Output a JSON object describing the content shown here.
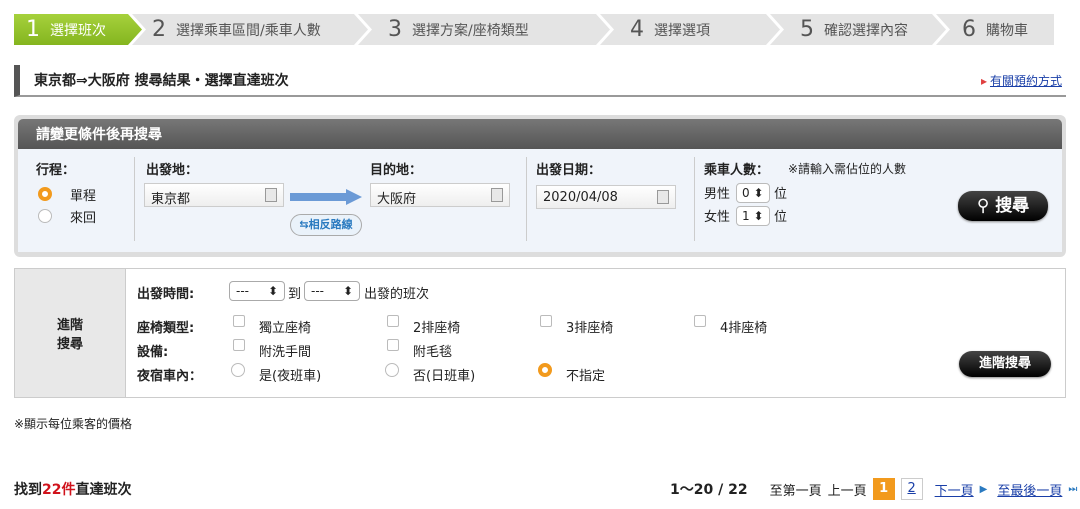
{
  "steps": [
    {
      "num": "1",
      "label": "選擇班次"
    },
    {
      "num": "2",
      "label": "選擇乘車區間/乘車人數"
    },
    {
      "num": "3",
      "label": "選擇方案/座椅類型"
    },
    {
      "num": "4",
      "label": "選擇選項"
    },
    {
      "num": "5",
      "label": "確認選擇內容"
    },
    {
      "num": "6",
      "label": "購物車"
    }
  ],
  "title": "東京都⇒大阪府 搜尋結果・選擇直達班次",
  "howto_link": "有關預約方式",
  "search": {
    "header": "請變更條件後再搜尋",
    "trip_label": "行程：",
    "one_way": "單程",
    "round_trip": "來回",
    "from_label": "出發地：",
    "from_value": "東京都",
    "to_label": "目的地：",
    "to_value": "大阪府",
    "reverse": "相反路線",
    "date_label": "出發日期：",
    "date_value": "2020/04/08",
    "pax_label": "乘車人數：",
    "pax_note": "※請輸入需佔位的人數",
    "male": "男性",
    "male_count": "0",
    "female": "女性",
    "female_count": "1",
    "unit": "位",
    "search_button": "搜尋"
  },
  "advanced": {
    "title_line1": "進階",
    "title_line2": "搜尋",
    "time_label": "出發時間:",
    "time_from": "---",
    "to": "到",
    "time_to": "---",
    "time_suffix": "出發的班次",
    "seat_label": "座椅類型:",
    "seats": [
      "獨立座椅",
      "2排座椅",
      "3排座椅",
      "4排座椅"
    ],
    "equip_label": "設備:",
    "equip": [
      "附洗手間",
      "附毛毯"
    ],
    "night_label": "夜宿車內：",
    "night": [
      "是(夜班車)",
      "否(日班車)",
      "不指定"
    ],
    "button": "進階搜尋"
  },
  "price_note": "※顯示每位乘客的價格",
  "found_prefix": "找到",
  "found_count": "22件",
  "found_suffix": "直達班次",
  "pager": {
    "range": "1〜20 / 22",
    "first": "至第一頁",
    "prev": "上一頁",
    "pages": [
      "1",
      "2"
    ],
    "next": "下一頁",
    "last": "至最後一頁"
  }
}
